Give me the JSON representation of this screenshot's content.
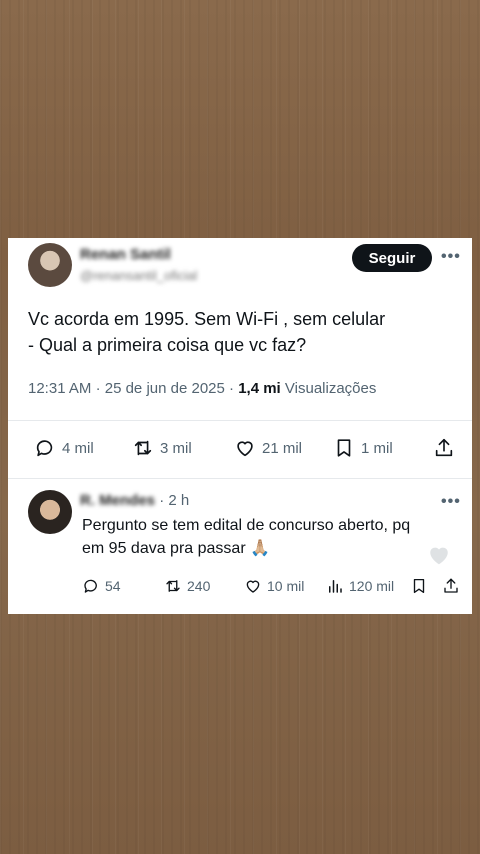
{
  "tweet": {
    "author_name": "Renan Santil",
    "author_handle": "@renansantil_oficial",
    "follow_label": "Seguir",
    "text_line1": "Vc acorda em 1995. Sem Wi-Fi , sem celular",
    "text_line2": "- Qual a primeira coisa que vc faz?",
    "time": "12:31 AM",
    "date": "25 de jun de 2025",
    "views_count": "1,4 mi",
    "views_label": "Visualizações",
    "actions": {
      "replies": "4 mil",
      "reposts": "3 mil",
      "likes": "21 mil",
      "bookmarks": "1 mil"
    }
  },
  "reply": {
    "author_name": "R. Mendes",
    "time": "2 h",
    "text_line1": "Pergunto se tem edital de concurso aberto, pq",
    "text_line2": "em 95 dava pra passar 🙏🏼",
    "actions": {
      "replies": "54",
      "reposts": "240",
      "likes": "10 mil",
      "views": "120 mil"
    }
  },
  "colors": {
    "text_primary": "#0f1419",
    "text_secondary": "#536471",
    "button_bg": "#0f1419",
    "divider": "#e6e9ec"
  },
  "icons": [
    "more-icon",
    "reply-icon",
    "repost-icon",
    "like-icon",
    "bookmark-icon",
    "share-icon",
    "views-icon"
  ]
}
